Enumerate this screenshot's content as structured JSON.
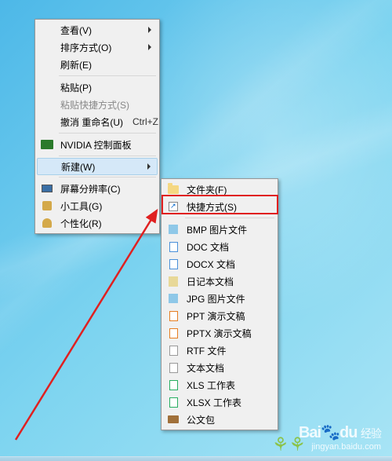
{
  "main_menu": {
    "view": "查看(V)",
    "sort": "排序方式(O)",
    "refresh": "刷新(E)",
    "paste": "粘贴(P)",
    "paste_shortcut": "粘贴快捷方式(S)",
    "undo": "撤消 重命名(U)",
    "undo_shortcut": "Ctrl+Z",
    "nvidia": "NVIDIA 控制面板",
    "new": "新建(W)",
    "screen_res": "屏幕分辨率(C)",
    "gadgets": "小工具(G)",
    "personalize": "个性化(R)"
  },
  "sub_menu": {
    "folder": "文件夹(F)",
    "shortcut": "快捷方式(S)",
    "bmp": "BMP 图片文件",
    "doc": "DOC 文档",
    "docx": "DOCX 文档",
    "diary": "日记本文档",
    "jpg": "JPG 图片文件",
    "ppt": "PPT 演示文稿",
    "pptx": "PPTX 演示文稿",
    "rtf": "RTF 文件",
    "txt": "文本文档",
    "xls": "XLS 工作表",
    "xlsx": "XLSX 工作表",
    "briefcase": "公文包"
  },
  "watermark": {
    "logo_en": "Bai",
    "logo_du": "du",
    "logo_cn": "经验",
    "url": "jingyan.baidu.com"
  }
}
